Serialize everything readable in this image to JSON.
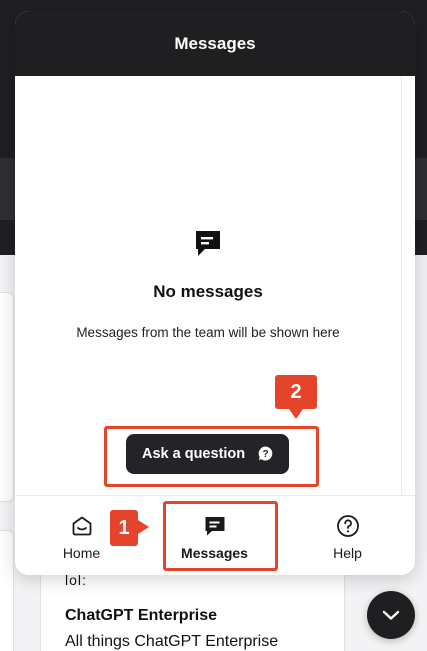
{
  "messenger": {
    "header_title": "Messages",
    "empty_state": {
      "icon": "message-icon",
      "title": "No messages",
      "description": "Messages from the team will be shown here"
    },
    "ask_button_label": "Ask a question",
    "ask_button_icon": "question-bubble-icon",
    "nav": [
      {
        "label": "Home",
        "icon": "home-icon",
        "active": false
      },
      {
        "label": "Messages",
        "icon": "message-icon",
        "active": true
      },
      {
        "label": "Help",
        "icon": "help-icon",
        "active": false
      }
    ]
  },
  "annotations": [
    {
      "label": "1",
      "target": "nav-messages"
    },
    {
      "label": "2",
      "target": "ask-question-button"
    }
  ],
  "background_page": {
    "card_icon": "lol:",
    "card_title": "ChatGPT Enterprise",
    "card_description": "All things ChatGPT Enterprise"
  },
  "launcher_icon": "chevron-down-icon",
  "colors": {
    "header_bg": "#1f1f22",
    "annotation": "#e4442a",
    "button_bg": "#242428"
  }
}
